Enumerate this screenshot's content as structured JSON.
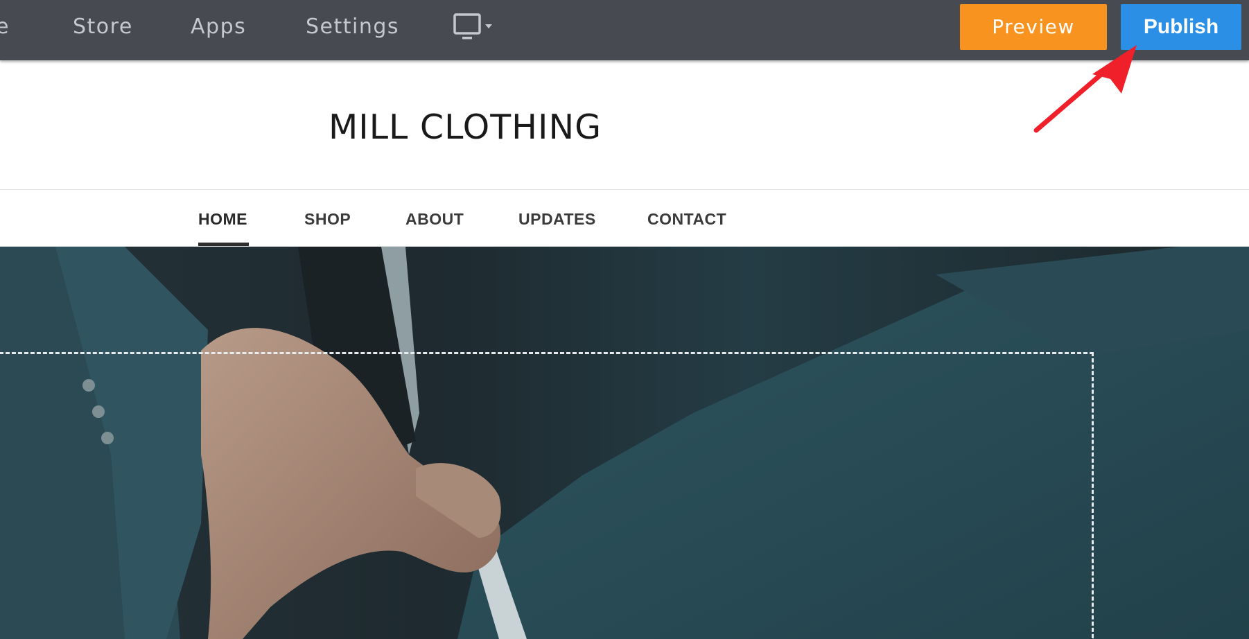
{
  "editor_toolbar": {
    "nav_items": [
      {
        "label": "e"
      },
      {
        "label": "Store"
      },
      {
        "label": "Apps"
      },
      {
        "label": "Settings"
      }
    ],
    "device_icon": "desktop-monitor-icon",
    "preview_label": "Preview",
    "publish_label": "Publish",
    "colors": {
      "toolbar_bg": "#474b51",
      "preview_bg": "#f7931e",
      "publish_bg": "#2b8fe6"
    }
  },
  "site": {
    "title": "MILL CLOTHING",
    "nav": [
      {
        "label": "HOME",
        "active": true
      },
      {
        "label": "SHOP",
        "active": false
      },
      {
        "label": "ABOUT",
        "active": false
      },
      {
        "label": "UPDATES",
        "active": false
      },
      {
        "label": "CONTACT",
        "active": false
      }
    ],
    "hero_image": "man-in-teal-suit-adjusting-shirt-cuff"
  },
  "annotation": {
    "icon": "red-arrow-pointing-to-publish",
    "color": "#f0202a"
  }
}
